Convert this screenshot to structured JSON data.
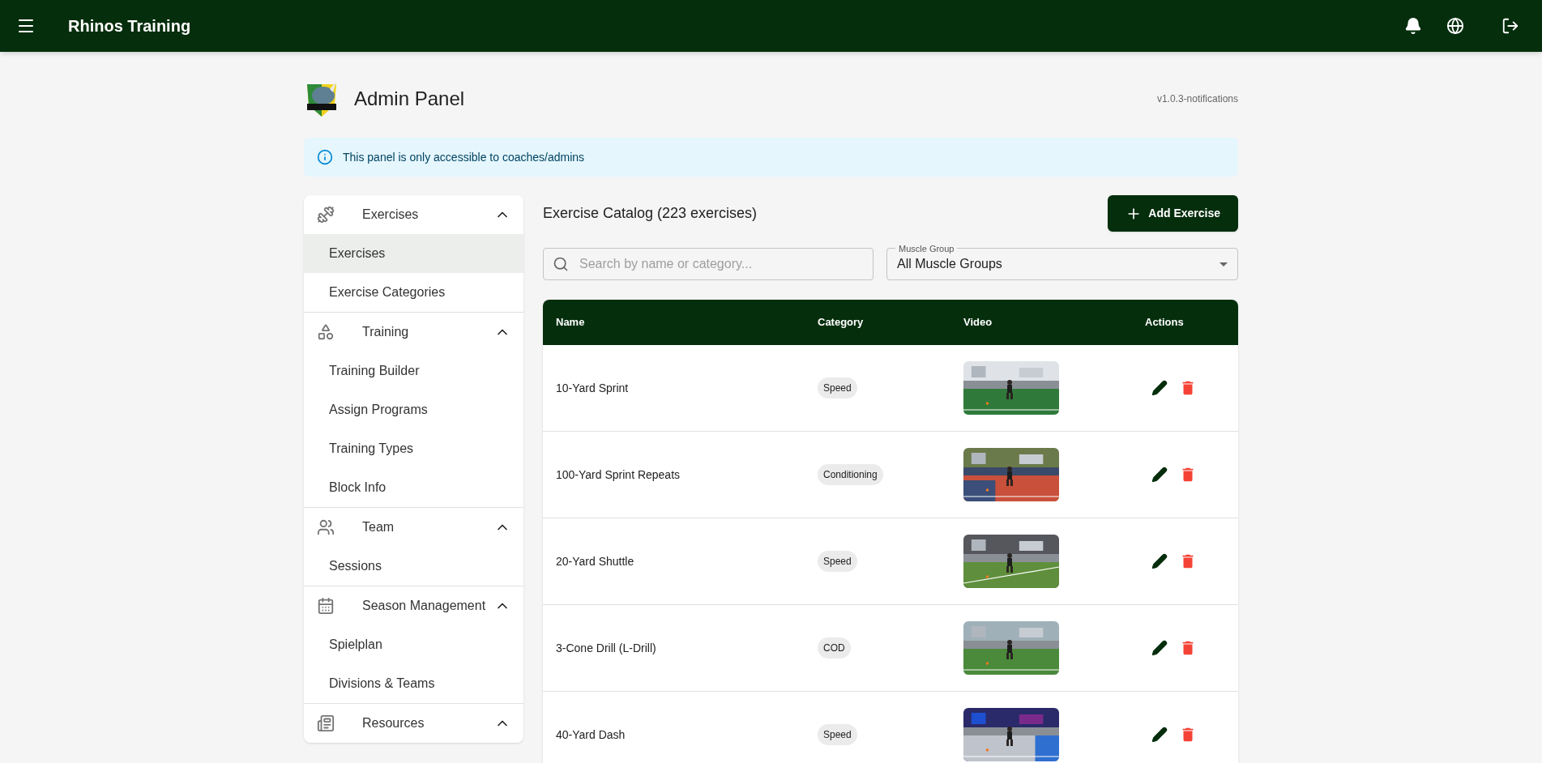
{
  "app_bar": {
    "title": "Rhinos Training"
  },
  "page": {
    "title": "Admin Panel",
    "version": "v1.0.3-notifications"
  },
  "alert": {
    "text": "This panel is only accessible to coaches/admins"
  },
  "sidebar": {
    "groups": [
      {
        "label": "Exercises",
        "expanded": true,
        "items": [
          {
            "label": "Exercises",
            "selected": true
          },
          {
            "label": "Exercise Categories",
            "selected": false
          }
        ]
      },
      {
        "label": "Training",
        "expanded": true,
        "items": [
          {
            "label": "Training Builder",
            "selected": false
          },
          {
            "label": "Assign Programs",
            "selected": false
          },
          {
            "label": "Training Types",
            "selected": false
          },
          {
            "label": "Block Info",
            "selected": false
          }
        ]
      },
      {
        "label": "Team",
        "expanded": true,
        "items": [
          {
            "label": "Sessions",
            "selected": false
          }
        ]
      },
      {
        "label": "Season Management",
        "expanded": true,
        "items": [
          {
            "label": "Spielplan",
            "selected": false
          },
          {
            "label": "Divisions & Teams",
            "selected": false
          }
        ]
      },
      {
        "label": "Resources",
        "expanded": true
      }
    ]
  },
  "catalog": {
    "title": "Exercise Catalog (223 exercises)",
    "add_button": "Add Exercise",
    "search": {
      "placeholder": "Search by name or category..."
    },
    "muscle_group": {
      "label": "Muscle Group",
      "value": "All Muscle Groups"
    },
    "table": {
      "columns": [
        "Name",
        "Category",
        "Video",
        "Actions"
      ],
      "rows": [
        {
          "name": "10-Yard Sprint",
          "category": "Speed"
        },
        {
          "name": "100-Yard Sprint Repeats",
          "category": "Conditioning"
        },
        {
          "name": "20-Yard Shuttle",
          "category": "Speed"
        },
        {
          "name": "3-Cone Drill (L-Drill)",
          "category": "COD"
        },
        {
          "name": "40-Yard Dash",
          "category": "Speed"
        }
      ]
    }
  }
}
